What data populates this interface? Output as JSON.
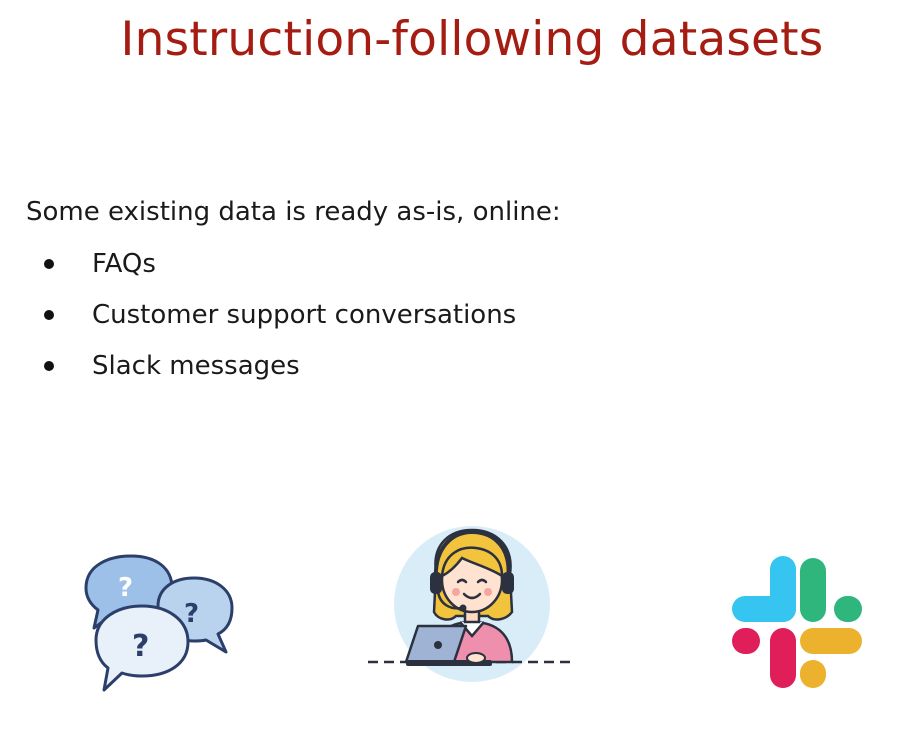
{
  "slide": {
    "title": "Instruction-following datasets",
    "intro": "Some existing data is ready as-is, online:",
    "bullets": [
      "FAQs",
      "Customer support conversations",
      "Slack messages"
    ]
  },
  "colors": {
    "title": "#a51d12",
    "bubble_outline": "#2c3f6b",
    "bubble_fill": "#b9d3ee",
    "agent_circle": "#d9edf8",
    "agent_shirt": "#ef8fae",
    "agent_hair": "#f2c33c",
    "slack_blue": "#36c5f0",
    "slack_green": "#2eb67d",
    "slack_red": "#e01e5a",
    "slack_yellow": "#ecb22e"
  },
  "icons": [
    "faq-question-bubbles-icon",
    "customer-support-agent-icon",
    "slack-logo-icon"
  ]
}
